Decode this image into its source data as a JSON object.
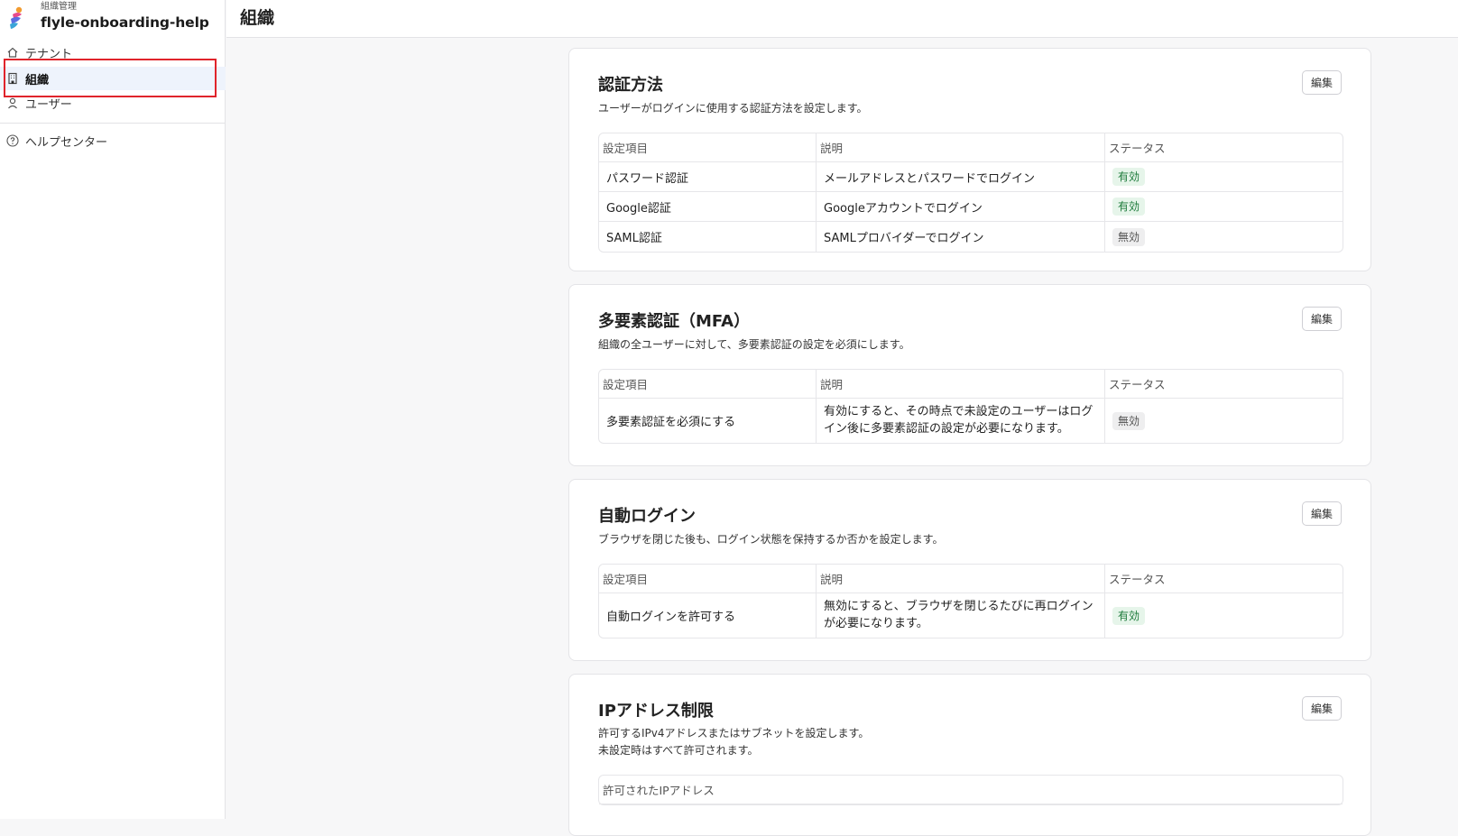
{
  "sidebar": {
    "org_label": "組織管理",
    "tenant_name": "flyle-onboarding-help",
    "items": [
      {
        "label": "テナント",
        "icon": "home-icon"
      },
      {
        "label": "組織",
        "icon": "building-icon",
        "active": true
      },
      {
        "label": "ユーザー",
        "icon": "user-icon"
      }
    ],
    "help_label": "ヘルプセンター"
  },
  "header": {
    "title": "組織"
  },
  "columns": {
    "item": "設定項目",
    "description": "説明",
    "status": "ステータス"
  },
  "edit_label": "編集",
  "auth": {
    "title": "認証方法",
    "desc": "ユーザーがログインに使用する認証方法を設定します。",
    "rows": [
      {
        "item": "パスワード認証",
        "description": "メールアドレスとパスワードでログイン",
        "status": "有効"
      },
      {
        "item": "Google認証",
        "description": "Googleアカウントでログイン",
        "status": "有効"
      },
      {
        "item": "SAML認証",
        "description": "SAMLプロバイダーでログイン",
        "status": "無効"
      }
    ]
  },
  "mfa": {
    "title": "多要素認証（MFA）",
    "desc": "組織の全ユーザーに対して、多要素認証の設定を必須にします。",
    "rows": [
      {
        "item": "多要素認証を必須にする",
        "description_line1": "有効にすると、その時点で未設定のユーザーはログ",
        "description_line2": "イン後に多要素認証の設定が必要になります。",
        "status": "無効"
      }
    ]
  },
  "autologin": {
    "title": "自動ログイン",
    "desc": "ブラウザを閉じた後も、ログイン状態を保持するか否かを設定します。",
    "rows": [
      {
        "item": "自動ログインを許可する",
        "description_line1": "無効にすると、ブラウザを閉じるたびに再ログイン",
        "description_line2": "が必要になります。",
        "status": "有効"
      }
    ]
  },
  "ip": {
    "title": "IPアドレス制限",
    "desc_line1": "許可するIPv4アドレスまたはサブネットを設定します。",
    "desc_line2": "未設定時はすべて許可されます。",
    "column": "許可されたIPアドレス"
  },
  "colors": {
    "accent": "#eef3fc",
    "highlight": "#e0242b",
    "enabled": "#1c7a3a",
    "disabled": "#555555"
  }
}
